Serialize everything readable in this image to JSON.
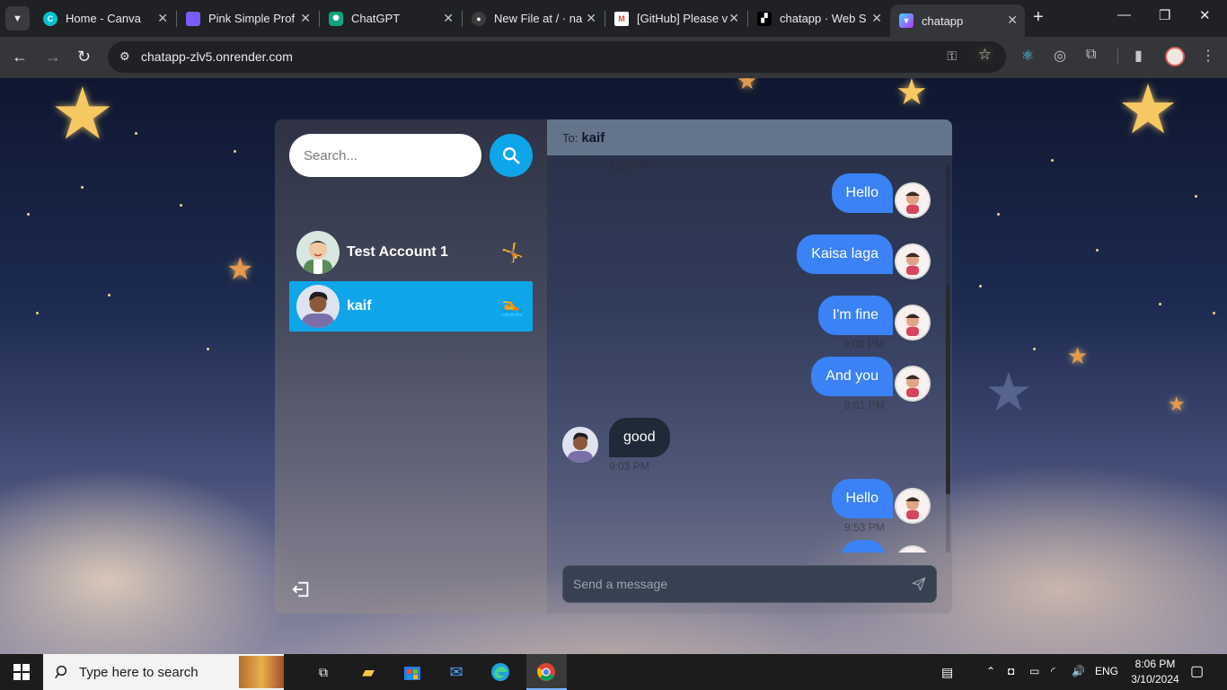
{
  "browser": {
    "tabs": [
      {
        "title": "Home - Canva",
        "active": false
      },
      {
        "title": "Pink Simple Prof",
        "active": false
      },
      {
        "title": "ChatGPT",
        "active": false
      },
      {
        "title": "New File at / · na",
        "active": false
      },
      {
        "title": "[GitHub] Please v",
        "active": false
      },
      {
        "title": "chatapp · Web S",
        "active": false
      },
      {
        "title": "chatapp",
        "active": true
      }
    ],
    "url": "chatapp-zlv5.onrender.com"
  },
  "sidebar": {
    "search_placeholder": "Search...",
    "contacts": [
      {
        "name": "Test Account 1",
        "emoji": "🤸",
        "selected": false
      },
      {
        "name": "kaif",
        "emoji": "🏊",
        "selected": true
      }
    ]
  },
  "chat": {
    "to_label": "To:",
    "to_name": "kaif",
    "top_time": "8:59 PM",
    "messages": [
      {
        "text": "Hello",
        "direction": "out",
        "time": ""
      },
      {
        "text": "Kaisa laga",
        "direction": "out",
        "time": ""
      },
      {
        "text": "I'm fine",
        "direction": "out",
        "time": "9:00 PM"
      },
      {
        "text": "And you",
        "direction": "out",
        "time": "9:01 PM"
      },
      {
        "text": "good",
        "direction": "in",
        "time": "9:03 PM"
      },
      {
        "text": "Hello",
        "direction": "out",
        "time": "9:53 PM"
      }
    ],
    "composer_placeholder": "Send a message"
  },
  "taskbar": {
    "search_placeholder": "Type here to search",
    "language": "ENG",
    "time": "8:06 PM",
    "date": "3/10/2024"
  },
  "colors": {
    "accent": "#0ea5e9",
    "outgoing_bubble": "#3b82f6",
    "incoming_bubble": "#1f2937",
    "chat_header": "#64748b"
  }
}
